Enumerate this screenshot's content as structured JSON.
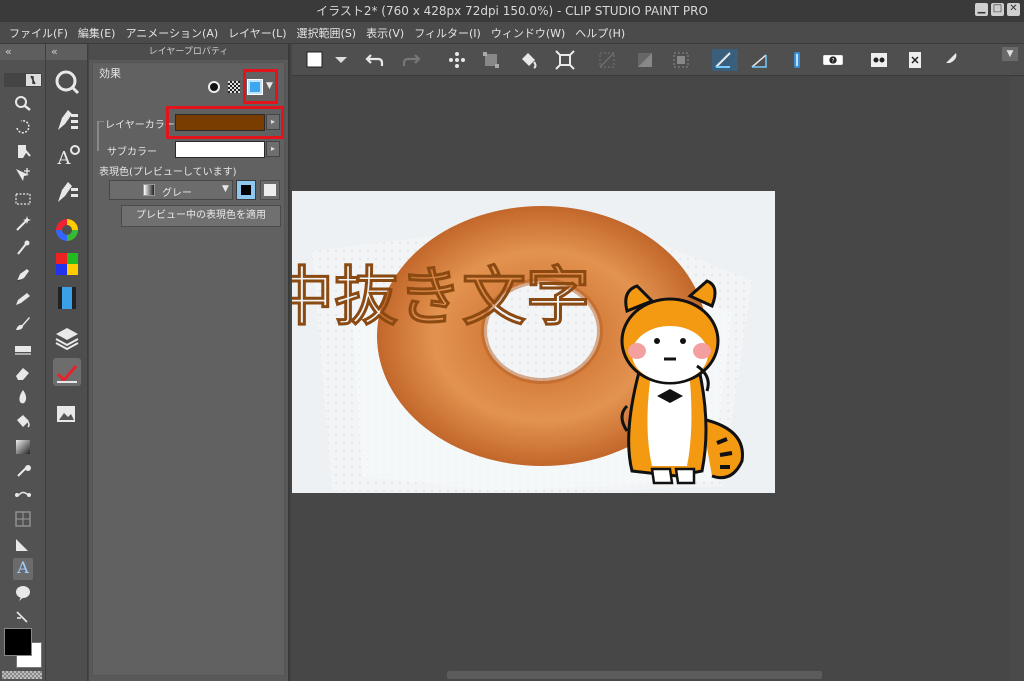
{
  "window": {
    "title": "イラスト2* (760 x 428px 72dpi 150.0%)  - CLIP STUDIO PAINT PRO",
    "controls": [
      "minimize",
      "maximize",
      "close"
    ]
  },
  "menu": [
    "ファイル(F)",
    "編集(E)",
    "アニメーション(A)",
    "レイヤー(L)",
    "選択範囲(S)",
    "表示(V)",
    "フィルター(I)",
    "ウィンドウ(W)",
    "ヘルプ(H)"
  ],
  "tool_icons": [
    "zoom-icon",
    "rotate-icon",
    "hand-move-icon",
    "operation-icon",
    "select-rect-icon",
    "magic-wand-icon",
    "eyedropper-icon",
    "pen-icon",
    "pencil-icon",
    "brush-icon",
    "decoration-icon",
    "eraser-icon",
    "blend-icon",
    "fill-icon",
    "gradient-icon",
    "figure-icon",
    "frame-icon",
    "ruler-icon",
    "text-icon",
    "balloon-icon",
    "correct-line-icon"
  ],
  "panel": {
    "title": "レイヤープロパティ",
    "effect_label": "効果",
    "layer_color_label": "レイヤーカラー",
    "layer_color": "#7a3d00",
    "sub_color_label": "サブカラー",
    "sub_color": "#ffffff",
    "expression_label": "表現色(プレビューしています)",
    "expression_value": "グレー",
    "apply_button": "プレビュー中の表現色を適用"
  },
  "canvas": {
    "heading_text": "中抜き文字",
    "text_outline_color": "#8a4a12"
  },
  "colors": {
    "highlight_red": "#e3131b",
    "main_color": "#000000",
    "sub_color": "#ffffff"
  }
}
